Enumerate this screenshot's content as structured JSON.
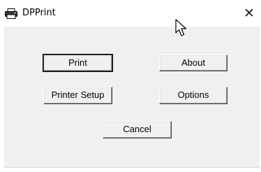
{
  "window": {
    "title": "DPPrint",
    "title_icon": "printer-icon",
    "close_glyph": "✕"
  },
  "buttons": {
    "print": "Print",
    "about": "About",
    "printer_setup": "Printer Setup",
    "options": "Options",
    "cancel": "Cancel"
  },
  "colors": {
    "dialog_background": "#f0f0f0",
    "titlebar_background": "#ffffff"
  }
}
